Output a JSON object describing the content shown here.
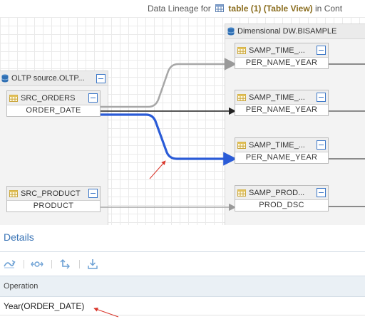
{
  "header": {
    "prefix": "Data Lineage for",
    "table_name": "table (1) (Table View)",
    "suffix": "in Cont"
  },
  "sources": {
    "group_label": "OLTP source.OLTP...",
    "orders": {
      "name": "SRC_ORDERS",
      "column": "ORDER_DATE"
    },
    "product": {
      "name": "SRC_PRODUCT",
      "column": "PRODUCT"
    }
  },
  "targets": {
    "group_label": "Dimensional DW.BISAMPLE",
    "nodes": [
      {
        "name": "SAMP_TIME_...",
        "column": "PER_NAME_YEAR"
      },
      {
        "name": "SAMP_TIME_...",
        "column": "PER_NAME_YEAR"
      },
      {
        "name": "SAMP_TIME_...",
        "column": "PER_NAME_YEAR"
      },
      {
        "name": "SAMP_PROD...",
        "column": "PROD_DSC"
      }
    ]
  },
  "details": {
    "title": "Details",
    "toolbar_icons": [
      "lineage-flow-icon",
      "impact-icon",
      "trace-icon",
      "export-icon"
    ],
    "column_header": "Operation",
    "operation": "Year(ORDER_DATE)"
  },
  "colors": {
    "highlight": "#2a5bd7",
    "accent": "#3a74b6",
    "annotation": "#d9352a"
  }
}
